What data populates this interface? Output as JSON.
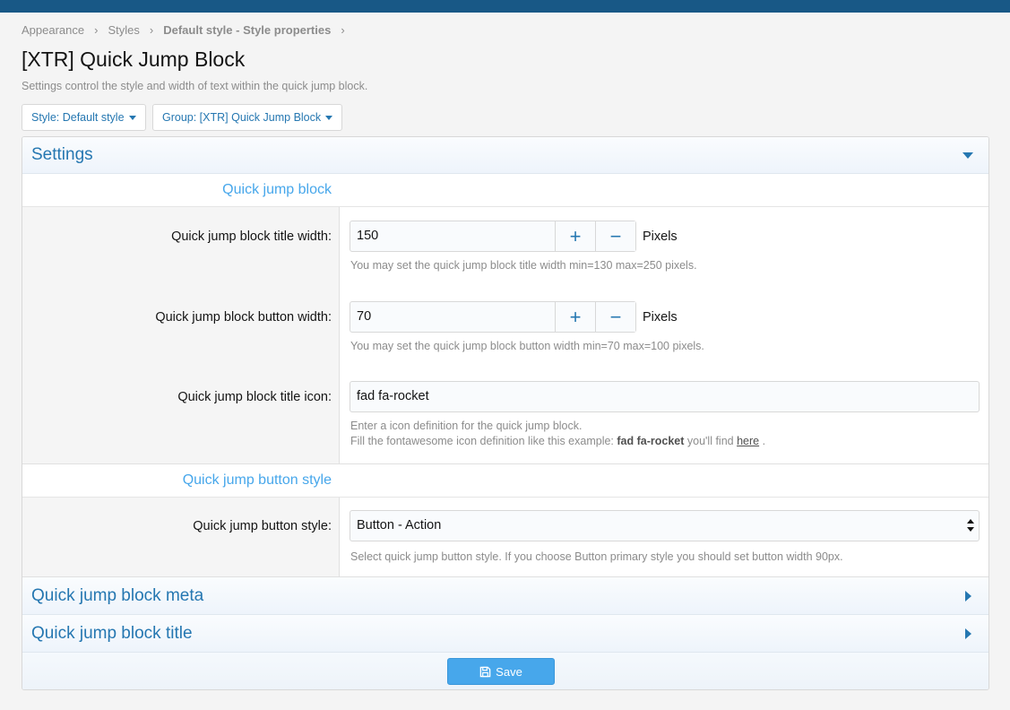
{
  "breadcrumb": {
    "items": [
      "Appearance",
      "Styles",
      "Default style - Style properties"
    ],
    "separator": "›"
  },
  "page": {
    "title": "[XTR] Quick Jump Block",
    "description": "Settings control the style and width of text within the quick jump block."
  },
  "filters": {
    "style_label": "Style: Default style",
    "group_label": "Group: [XTR] Quick Jump Block"
  },
  "settings": {
    "title": "Settings",
    "group1": {
      "title": "Quick jump block",
      "title_width": {
        "label": "Quick jump block title width:",
        "value": "150",
        "unit": "Pixels",
        "hint": "You may set the quick jump block title width min=130 max=250 pixels."
      },
      "button_width": {
        "label": "Quick jump block button width:",
        "value": "70",
        "unit": "Pixels",
        "hint": "You may set the quick jump block button width min=70 max=100 pixels."
      },
      "title_icon": {
        "label": "Quick jump block title icon:",
        "value": "fad fa-rocket",
        "hint_line1": "Enter a icon definition for the quick jump block.",
        "hint_line2_prefix": "Fill the fontawesome icon definition like this example: ",
        "hint_line2_bold": "fad fa-rocket",
        "hint_line2_mid": " you'll find ",
        "hint_line2_link": "here",
        "hint_line2_suffix": " ."
      }
    },
    "group2": {
      "title": "Quick jump button style",
      "button_style": {
        "label": "Quick jump button style:",
        "value": "Button - Action",
        "hint": "Select quick jump button style. If you choose Button primary style you should set button width 90px."
      }
    }
  },
  "sections": {
    "meta": "Quick jump block meta",
    "title": "Quick jump block title"
  },
  "stepper": {
    "plus": "+",
    "minus": "−"
  },
  "footer": {
    "save_label": "Save"
  },
  "colors": {
    "accent": "#2577b1",
    "light_accent": "#47a7eb",
    "topbar": "#185886"
  }
}
